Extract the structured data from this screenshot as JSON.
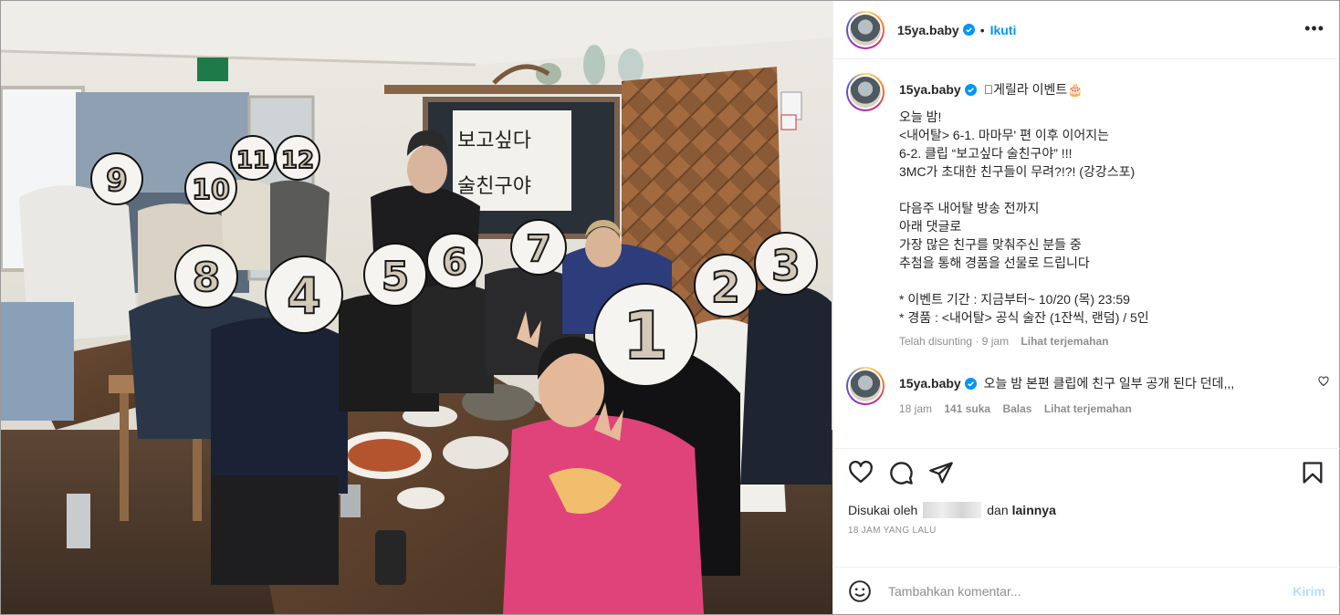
{
  "post": {
    "photo_alt": "",
    "badges": [
      "1",
      "2",
      "3",
      "4",
      "5",
      "6",
      "7",
      "8",
      "9",
      "10",
      "11",
      "12"
    ],
    "sign_text": "보고싶다 술친구야"
  },
  "header": {
    "username": "15ya.baby",
    "separator": "•",
    "follow_label": "Ikuti",
    "more_label": "•••"
  },
  "caption": {
    "username": "15ya.baby",
    "first_line": "\u0000게릴라 이벤트🎂",
    "text": "오늘 밤!\n<내어탈> 6-1. 마마무' 편 이후 이어지는\n6-2. 클립 “보고싶다 술친구야” !!!\n3MC가 초대한 친구들이 무려?!?! (강강스포)\n\n다음주 내어탈 방송 전까지\n아래 댓글로\n가장 많은 친구를 맞춰주신 분들 중\n추첨을 통해 경품을 선물로 드립니다\n\n* 이벤트 기간 : 지금부터~ 10/20 (목) 23:59\n* 경품 : <내어탈> 공식 술잔 (1잔씩, 랜덤) / 5인",
    "edited": "Telah disunting · 9 jam",
    "translate": "Lihat terjemahan"
  },
  "comment": {
    "username": "15ya.baby",
    "text": "오늘 밤 본편 클립에 친구 일부 공개 된다 던데,,,",
    "time": "18 jam",
    "likes": "141 suka",
    "reply": "Balas",
    "translate": "Lihat terjemahan"
  },
  "actions": {
    "liked_by_prefix": "Disukai oleh",
    "liked_by_and": "dan",
    "liked_by_others": "lainnya",
    "timestamp": "18 JAM YANG LALU"
  },
  "add_comment": {
    "placeholder": "Tambahkan komentar...",
    "send_label": "Kirim"
  },
  "colors": {
    "link_blue": "#0095f6",
    "send_disabled": "#b2dffc",
    "muted": "#8e8e8e",
    "verified": "#0095f6",
    "sweater_pink": "#e0437a"
  }
}
